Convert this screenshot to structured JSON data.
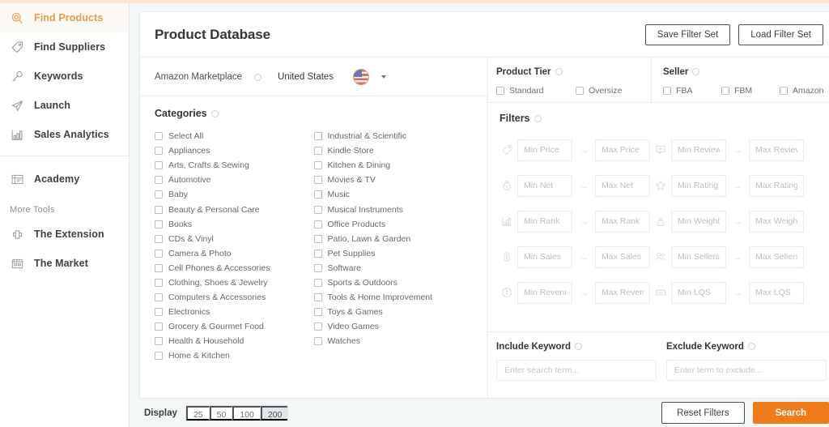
{
  "colors": {
    "accent": "#ee7b1b",
    "accent_soft": "#e49b4f",
    "top_strip": "#fbe6d2",
    "page_bg": "#f4f7f8"
  },
  "sidebar": {
    "items": [
      {
        "label": "Find Products",
        "icon": "magnifier-icon",
        "active": true
      },
      {
        "label": "Find Suppliers",
        "icon": "tag-icon",
        "active": false
      },
      {
        "label": "Keywords",
        "icon": "key-icon",
        "active": false
      },
      {
        "label": "Launch",
        "icon": "paper-plane-icon",
        "active": false
      },
      {
        "label": "Sales Analytics",
        "icon": "bar-chart-icon",
        "active": false
      }
    ],
    "academy": {
      "label": "Academy",
      "icon": "book-icon"
    },
    "more_tools_label": "More Tools",
    "tools": [
      {
        "label": "The Extension",
        "icon": "puzzle-icon"
      },
      {
        "label": "The Market",
        "icon": "storefront-icon"
      }
    ]
  },
  "header": {
    "title": "Product Database",
    "save_filter_set": "Save Filter Set",
    "load_filter_set": "Load Filter Set"
  },
  "marketplace": {
    "label": "Amazon Marketplace",
    "value": "United States",
    "flag": "us-flag-icon"
  },
  "categories": {
    "title": "Categories",
    "col1": [
      "Select All",
      "Appliances",
      "Arts, Crafts & Sewing",
      "Automotive",
      "Baby",
      "Beauty & Personal Care",
      "Books",
      "CDs & Vinyl",
      "Camera & Photo",
      "Cell Phones & Accessories",
      "Clothing, Shoes & Jewelry",
      "Computers & Accessories",
      "Electronics",
      "Grocery & Gourmet Food",
      "Health & Household",
      "Home & Kitchen"
    ],
    "col2": [
      "Industrial & Scientific",
      "Kindle Store",
      "Kitchen & Dining",
      "Movies & TV",
      "Music",
      "Musical Instruments",
      "Office Products",
      "Patio, Lawn & Garden",
      "Pet Supplies",
      "Software",
      "Sports & Outdoors",
      "Tools & Home Improvement",
      "Toys & Games",
      "Video Games",
      "Watches"
    ]
  },
  "product_tier": {
    "title": "Product Tier",
    "options": [
      "Standard",
      "Oversize"
    ]
  },
  "seller": {
    "title": "Seller",
    "options": [
      "FBA",
      "FBM",
      "Amazon"
    ]
  },
  "filters": {
    "title": "Filters",
    "rows": [
      {
        "left_icon": "price-tag-icon",
        "left_min": "Min Price",
        "left_max": "Max Price",
        "right_icon": "comment-icon",
        "right_min": "Min Reviews",
        "right_max": "Max Reviews"
      },
      {
        "left_icon": "money-bag-icon",
        "left_min": "Min Net",
        "left_max": "Max Net",
        "right_icon": "star-icon",
        "right_min": "Min Rating",
        "right_max": "Max Rating"
      },
      {
        "left_icon": "bar-chart-icon",
        "left_min": "Min Rank",
        "left_max": "Max Rank",
        "right_icon": "weight-icon",
        "right_min": "Min Weight",
        "right_max": "Max Weight"
      },
      {
        "left_icon": "dollar-coin-icon",
        "left_min": "Min Sales",
        "left_max": "Max Sales",
        "right_icon": "users-icon",
        "right_min": "Min Sellers",
        "right_max": "Max Sellers"
      },
      {
        "left_icon": "revenue-icon",
        "left_min": "Min Revenue",
        "left_max": "Max Revenue",
        "right_icon": "badge-icon",
        "right_min": "Min LQS",
        "right_max": "Max LQS"
      }
    ],
    "arrow": "→"
  },
  "keywords": {
    "include_title": "Include Keyword",
    "include_placeholder": "Enter search term...",
    "include_value": "",
    "exclude_title": "Exclude Keyword",
    "exclude_placeholder": "Enter term to exclude...",
    "exclude_value": ""
  },
  "footer": {
    "display_label": "Display",
    "display_options": [
      "25",
      "50",
      "100",
      "200"
    ],
    "display_selected": "200",
    "reset_label": "Reset Filters",
    "search_label": "Search"
  }
}
